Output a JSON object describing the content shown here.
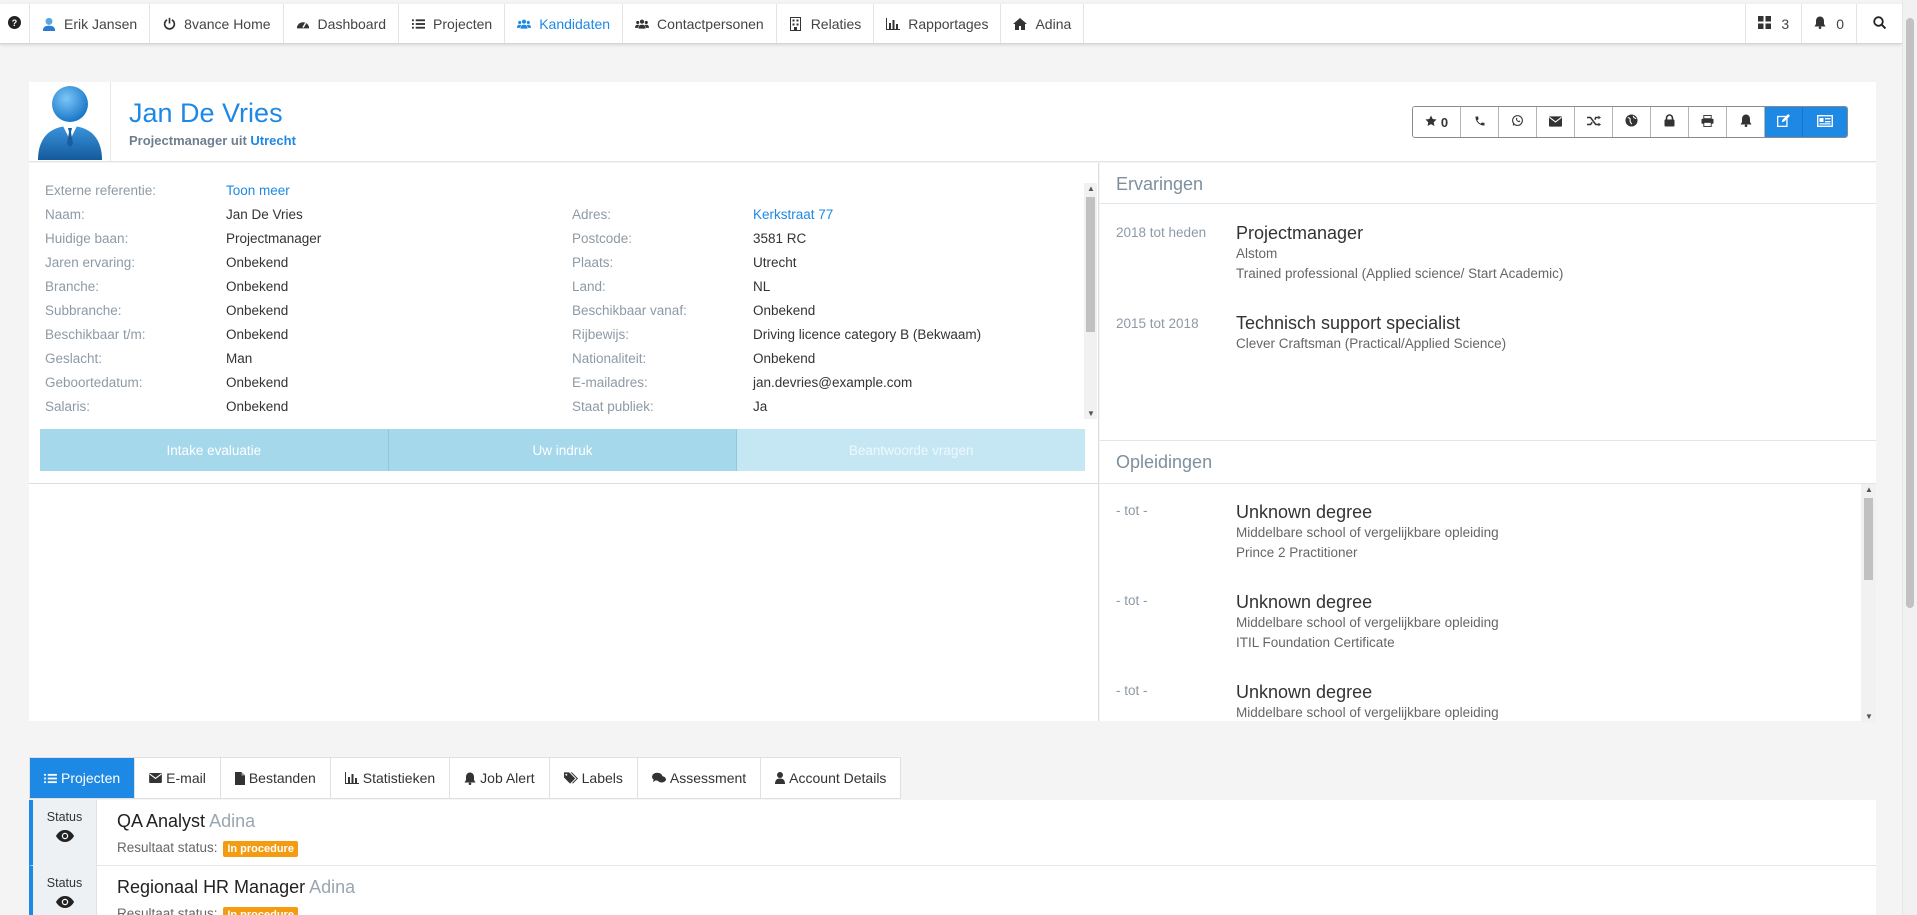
{
  "nav": {
    "help_icon": "question-circle-icon",
    "items": [
      {
        "icon": "user-icon",
        "label": "Erik Jansen"
      },
      {
        "icon": "power-icon",
        "label": "8vance Home"
      },
      {
        "icon": "dashboard-icon",
        "label": "Dashboard"
      },
      {
        "icon": "list-icon",
        "label": "Projecten"
      },
      {
        "icon": "users-icon",
        "label": "Kandidaten",
        "active": true
      },
      {
        "icon": "users-icon",
        "label": "Contactpersonen"
      },
      {
        "icon": "building-icon",
        "label": "Relaties"
      },
      {
        "icon": "bar-chart-icon",
        "label": "Rapportages"
      },
      {
        "icon": "home-icon",
        "label": "Adina"
      }
    ],
    "grid_count": "3",
    "bell_count": "0"
  },
  "profile": {
    "name": "Jan De Vries",
    "role": "Projectmanager",
    "from_word": "uit",
    "city": "Utrecht",
    "favorite_count": "0"
  },
  "details_left": [
    {
      "label": "Externe referentie:",
      "value": "Toon meer",
      "link": true
    },
    {
      "label": "Naam:",
      "value": "Jan De Vries"
    },
    {
      "label": "Huidige baan:",
      "value": "Projectmanager"
    },
    {
      "label": "Jaren ervaring:",
      "value": "Onbekend"
    },
    {
      "label": "Branche:",
      "value": "Onbekend"
    },
    {
      "label": "Subbranche:",
      "value": "Onbekend"
    },
    {
      "label": "Beschikbaar t/m:",
      "value": "Onbekend"
    },
    {
      "label": "Geslacht:",
      "value": "Man"
    },
    {
      "label": "Geboortedatum:",
      "value": "Onbekend"
    },
    {
      "label": "Salaris:",
      "value": "Onbekend"
    }
  ],
  "details_right": [
    {
      "label": "Adres:",
      "value": "Kerkstraat 77",
      "link": true
    },
    {
      "label": "Postcode:",
      "value": "3581 RC"
    },
    {
      "label": "Plaats:",
      "value": "Utrecht"
    },
    {
      "label": "Land:",
      "value": "NL"
    },
    {
      "label": "Beschikbaar vanaf:",
      "value": "Onbekend"
    },
    {
      "label": "Rijbewijs:",
      "value": "Driving licence category B (Bekwaam)"
    },
    {
      "label": "Nationaliteit:",
      "value": "Onbekend"
    },
    {
      "label": "E-mailadres:",
      "value": "jan.devries@example.com"
    },
    {
      "label": "Staat publiek:",
      "value": "Ja"
    }
  ],
  "eval_tabs": [
    "Intake evaluatie",
    "Uw indruk",
    "Beantwoorde vragen"
  ],
  "ervaringen": {
    "title": "Ervaringen",
    "entries": [
      {
        "period": "2018 tot heden",
        "title": "Projectmanager",
        "lines": [
          "Alstom",
          "Trained professional (Applied science/ Start Academic)"
        ]
      },
      {
        "period": "2015 tot 2018",
        "title": "Technisch support specialist",
        "lines": [
          "Clever Craftsman (Practical/Applied Science)"
        ]
      }
    ]
  },
  "opleidingen": {
    "title": "Opleidingen",
    "entries": [
      {
        "period": "- tot -",
        "title": "Unknown degree",
        "lines": [
          "Middelbare school of vergelijkbare opleiding",
          "Prince 2 Practitioner"
        ]
      },
      {
        "period": "- tot -",
        "title": "Unknown degree",
        "lines": [
          "Middelbare school of vergelijkbare opleiding",
          "ITIL Foundation Certificate"
        ]
      },
      {
        "period": "- tot -",
        "title": "Unknown degree",
        "lines": [
          "Middelbare school of vergelijkbare opleiding"
        ]
      }
    ]
  },
  "bottom_tabs": [
    {
      "icon": "list-icon",
      "label": "Projecten",
      "active": true
    },
    {
      "icon": "envelope-icon",
      "label": "E-mail"
    },
    {
      "icon": "file-icon",
      "label": "Bestanden"
    },
    {
      "icon": "bar-chart-icon",
      "label": "Statistieken"
    },
    {
      "icon": "bell-icon",
      "label": "Job Alert"
    },
    {
      "icon": "tags-icon",
      "label": "Labels"
    },
    {
      "icon": "comments-icon",
      "label": "Assessment"
    },
    {
      "icon": "user-icon",
      "label": "Account Details"
    }
  ],
  "projects": [
    {
      "status_label": "Status",
      "title": "QA Analyst",
      "owner": "Adina",
      "result_label": "Resultaat status:",
      "badge": "In procedure"
    },
    {
      "status_label": "Status",
      "title": "Regionaal HR Manager",
      "owner": "Adina",
      "result_label": "Resultaat status:",
      "badge": "In procedure"
    }
  ],
  "colors": {
    "accent": "#1e88e5",
    "badge": "#f39c12",
    "tab_light": "#a4d8ea"
  }
}
